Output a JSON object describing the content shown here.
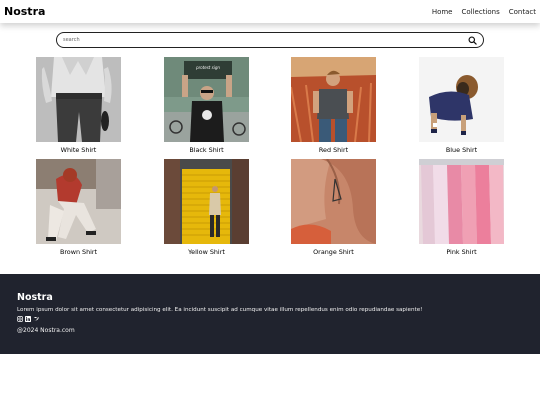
{
  "header": {
    "brand": "Nostra",
    "links": [
      "Home",
      "Collections",
      "Contact"
    ]
  },
  "search": {
    "placeholder": "search",
    "value": ""
  },
  "products": [
    {
      "name": "White Shirt"
    },
    {
      "name": "Black Shirt"
    },
    {
      "name": "Red Shirt"
    },
    {
      "name": "Blue Shirt"
    },
    {
      "name": "Brown Shirt"
    },
    {
      "name": "Yellow Shirt"
    },
    {
      "name": "Orange Shirt"
    },
    {
      "name": "Pink Shirt"
    }
  ],
  "footer": {
    "brand": "Nostra",
    "text": "Lorem ipsum dolor sit amet consectetur adipisicing elit. Ea incidunt suscipit ad cumque vitae illum repellendus enim odio repudiandae sapiente!",
    "social_icons": [
      "instagram-icon",
      "linkedin-icon",
      "twitter-icon"
    ],
    "copyright": "@2024 Nostra.com"
  },
  "colors": {
    "footer_bg": "#20232e",
    "text": "#000000"
  }
}
